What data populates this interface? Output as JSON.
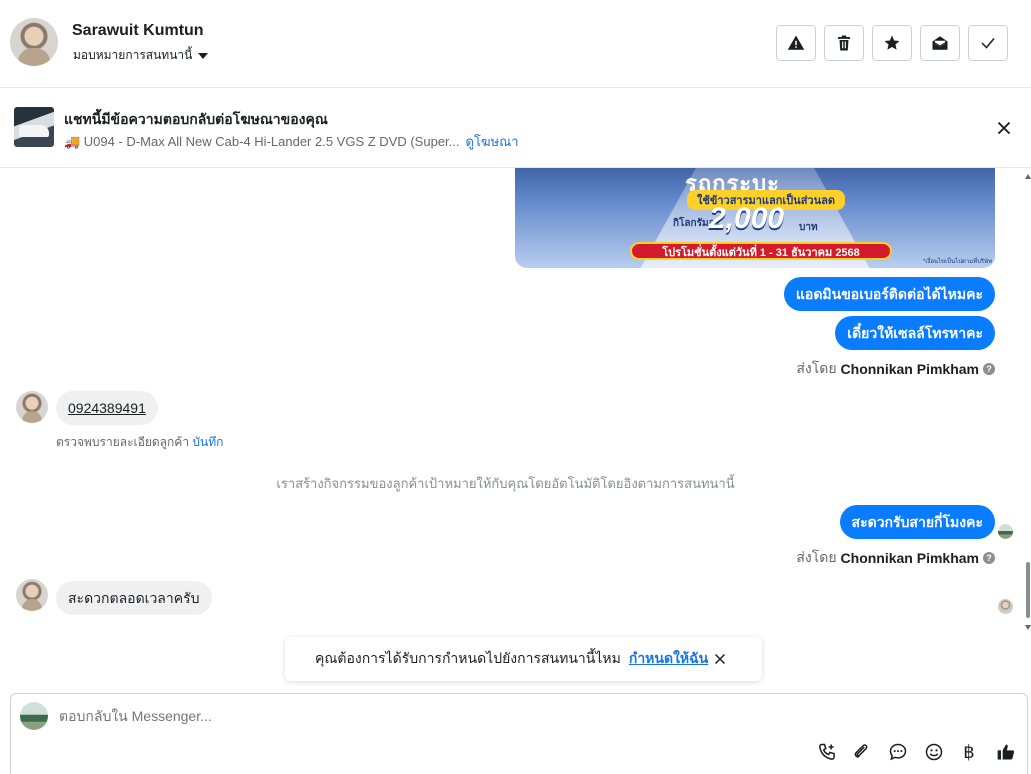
{
  "header": {
    "contact_name": "Sarawuit Kumtun",
    "assign_label": "มอบหมายการสนทนานี้",
    "actions": [
      {
        "name": "mark-spam-button",
        "icon": "warning-icon"
      },
      {
        "name": "delete-button",
        "icon": "trash-icon"
      },
      {
        "name": "star-button",
        "icon": "star-icon"
      },
      {
        "name": "mark-unread-button",
        "icon": "envelope-open-icon"
      },
      {
        "name": "mark-done-button",
        "icon": "check-icon"
      }
    ]
  },
  "ad_banner": {
    "title": "แชทนี้มีข้อความตอบกลับต่อโฆษณาของคุณ",
    "product": "🚚 U094 - D-Max All New Cab-4 Hi-Lander 2.5 VGS Z DVD (Super...",
    "view_ad_link": "ดูโฆษณา"
  },
  "promo_image": {
    "headline": "รถกระบะ",
    "pill": "ใช้ข้าวสารมาแลกเป็นส่วนลด",
    "per_kg": "กิโลกรัมละ",
    "amount": "2,000",
    "currency": "บาท",
    "period": "โปรโมชั่นตั้งแต่วันที่ 1 - 31 ธันวาคม 2568",
    "fine_print": "*เงื่อนไขเป็นไปตามที่บริษัท กำหนด"
  },
  "messages": {
    "out1": "แอดมินขอเบอร์ติดต่อได้ไหมคะ",
    "out2": "เดี๋ยวให้เซลล์โทรหาคะ",
    "sent_by_prefix": "ส่งโดย",
    "sent_by_name": "Chonnikan Pimkham",
    "in_phone": "0924389491",
    "detected_text": "ตรวจพบรายละเอียดลูกค้า",
    "detected_save": "บันทึก",
    "system_note": "เราสร้างกิจกรรมของลูกค้าเป้าหมายให้กับคุณโดยอัตโนมัติโดยอิงตามการสนทนานี้",
    "out3": "สะดวกรับสายกี่โมงคะ",
    "sent_by_prefix_2": "ส่งโดย",
    "sent_by_name_2": "Chonnikan Pimkham",
    "in_last": "สะดวกตลอดเวลาครับ"
  },
  "assign_toast": {
    "question": "คุณต้องการได้รับการกำหนดไปยังการสนทนานี้ไหม",
    "assign_me": "กำหนดให้ฉัน"
  },
  "composer": {
    "placeholder": "ตอบกลับใน Messenger...",
    "baht_symbol": "฿"
  },
  "colors": {
    "accent": "#0a7cff",
    "link": "#1b74e4",
    "incoming_bubble": "#f0f0f0"
  }
}
